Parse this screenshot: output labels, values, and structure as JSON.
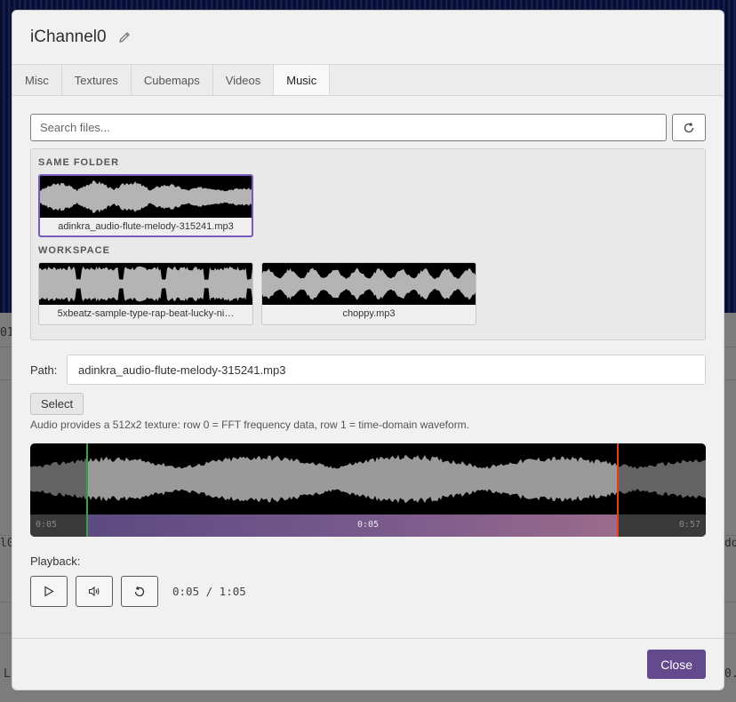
{
  "dialog": {
    "title": "iChannel0",
    "tabs": [
      {
        "label": "Misc",
        "active": false
      },
      {
        "label": "Textures",
        "active": false
      },
      {
        "label": "Cubemaps",
        "active": false
      },
      {
        "label": "Videos",
        "active": false
      },
      {
        "label": "Music",
        "active": true
      }
    ],
    "search": {
      "placeholder": "Search files...",
      "value": ""
    },
    "sections": {
      "same_folder": {
        "label": "SAME FOLDER",
        "files": [
          {
            "name": "adinkra_audio-flute-melody-315241.mp3",
            "selected": true
          }
        ]
      },
      "workspace": {
        "label": "WORKSPACE",
        "files": [
          {
            "name": "5xbeatz-sample-type-rap-beat-lucky-ni…",
            "selected": false
          },
          {
            "name": "choppy.mp3",
            "selected": false
          }
        ]
      }
    },
    "path": {
      "label": "Path:",
      "value": "adinkra_audio-flute-melody-315241.mp3"
    },
    "select_label": "Select",
    "hint": "Audio provides a 512x2 texture: row 0 = FFT frequency data, row 1 = time-domain waveform.",
    "waveform": {
      "time_start": "0:05",
      "time_current": "0:05",
      "time_end": "0:57"
    },
    "playback": {
      "label": "Playback:",
      "time_display": "0:05 / 1:05"
    },
    "close_label": "Close"
  },
  "colors": {
    "accent": "#624a8d",
    "selected_border": "#7a5bbd",
    "loop_start_marker": "#3aa047",
    "loop_end_marker": "#e0401a"
  },
  "icons": [
    "pencil-icon",
    "refresh-icon",
    "play-icon",
    "volume-icon",
    "restart-icon"
  ],
  "background_fragments": [
    "01",
    "l0",
    "dd",
    "L'",
    "0."
  ]
}
